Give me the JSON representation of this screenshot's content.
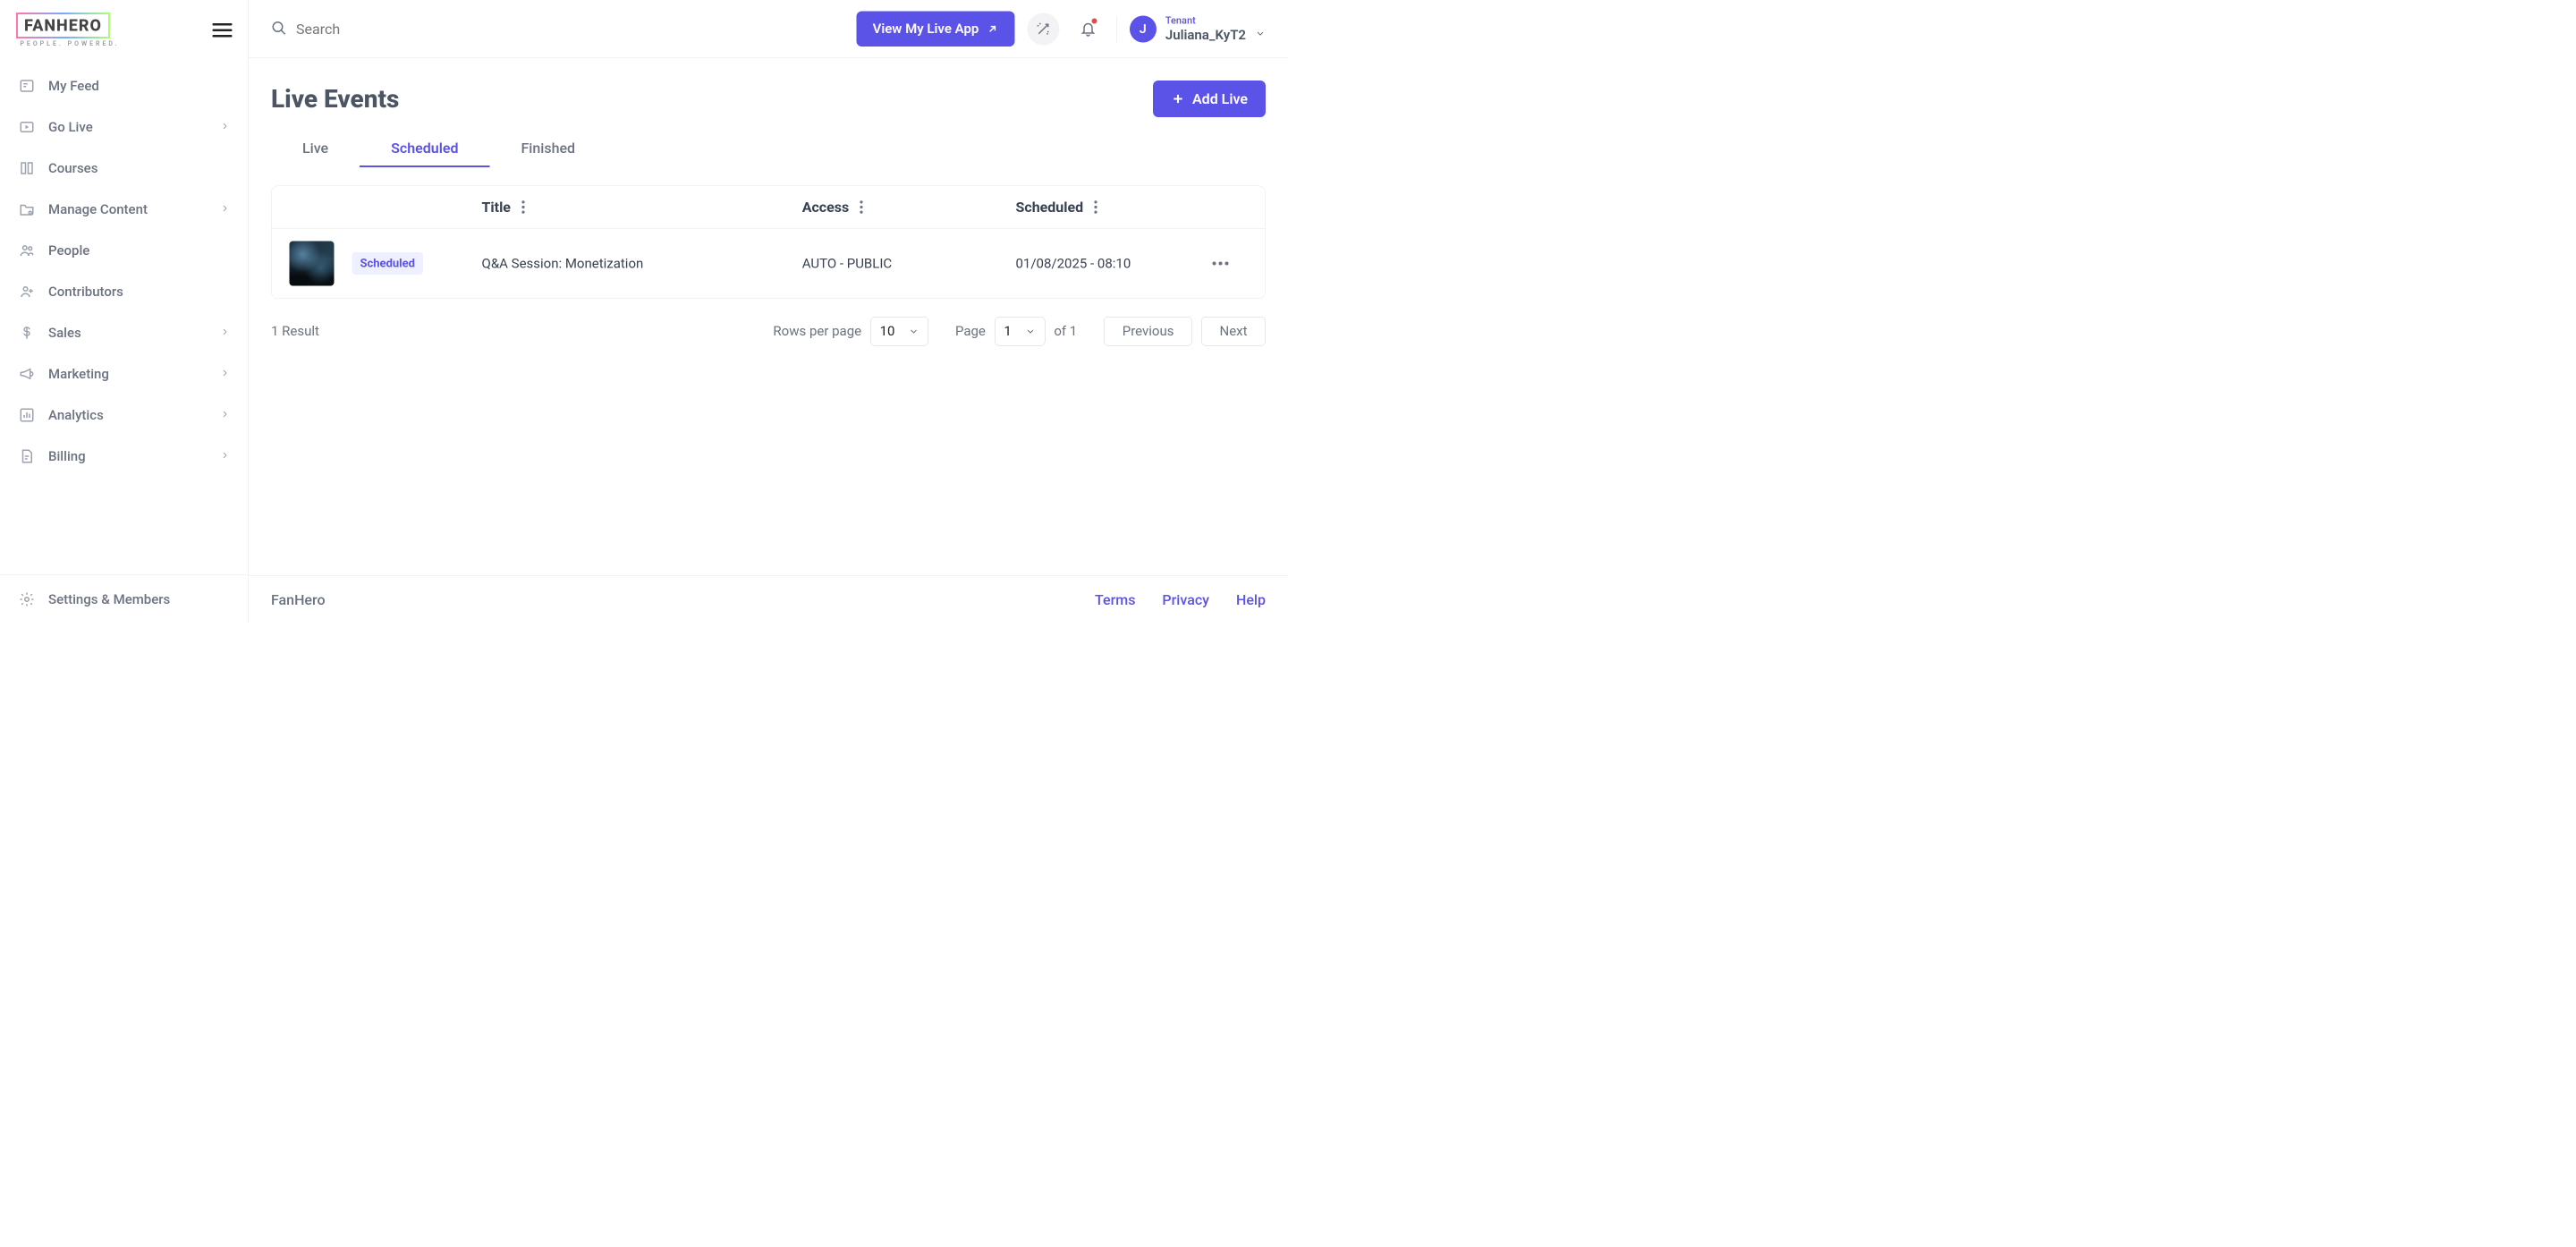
{
  "brand": {
    "name": "FANHERO",
    "tagline": "PEOPLE. POWERED.",
    "footer": "FanHero"
  },
  "search": {
    "placeholder": "Search"
  },
  "topbar": {
    "view_app": "View My Live App",
    "tenant_label": "Tenant",
    "tenant_name": "Juliana_KyT2",
    "avatar_initial": "J"
  },
  "sidebar": {
    "items": [
      {
        "label": "My Feed",
        "chevron": false
      },
      {
        "label": "Go Live",
        "chevron": true
      },
      {
        "label": "Courses",
        "chevron": false
      },
      {
        "label": "Manage Content",
        "chevron": true
      },
      {
        "label": "People",
        "chevron": false
      },
      {
        "label": "Contributors",
        "chevron": false
      },
      {
        "label": "Sales",
        "chevron": true
      },
      {
        "label": "Marketing",
        "chevron": true
      },
      {
        "label": "Analytics",
        "chevron": true
      },
      {
        "label": "Billing",
        "chevron": true
      }
    ],
    "settings": "Settings & Members"
  },
  "page": {
    "title": "Live Events",
    "add_label": "Add Live",
    "tabs": {
      "live": "Live",
      "scheduled": "Scheduled",
      "finished": "Finished"
    },
    "columns": {
      "title": "Title",
      "access": "Access",
      "scheduled": "Scheduled"
    },
    "rows": [
      {
        "status": "Scheduled",
        "title": "Q&A Session: Monetization",
        "access": "AUTO - PUBLIC",
        "scheduled": "01/08/2025 - 08:10"
      }
    ],
    "result_text": "1 Result",
    "rows_per_page_label": "Rows per page",
    "rows_per_page_value": "10",
    "page_label": "Page",
    "page_value": "1",
    "page_of": "of 1",
    "prev": "Previous",
    "next": "Next"
  },
  "footer": {
    "terms": "Terms",
    "privacy": "Privacy",
    "help": "Help"
  }
}
